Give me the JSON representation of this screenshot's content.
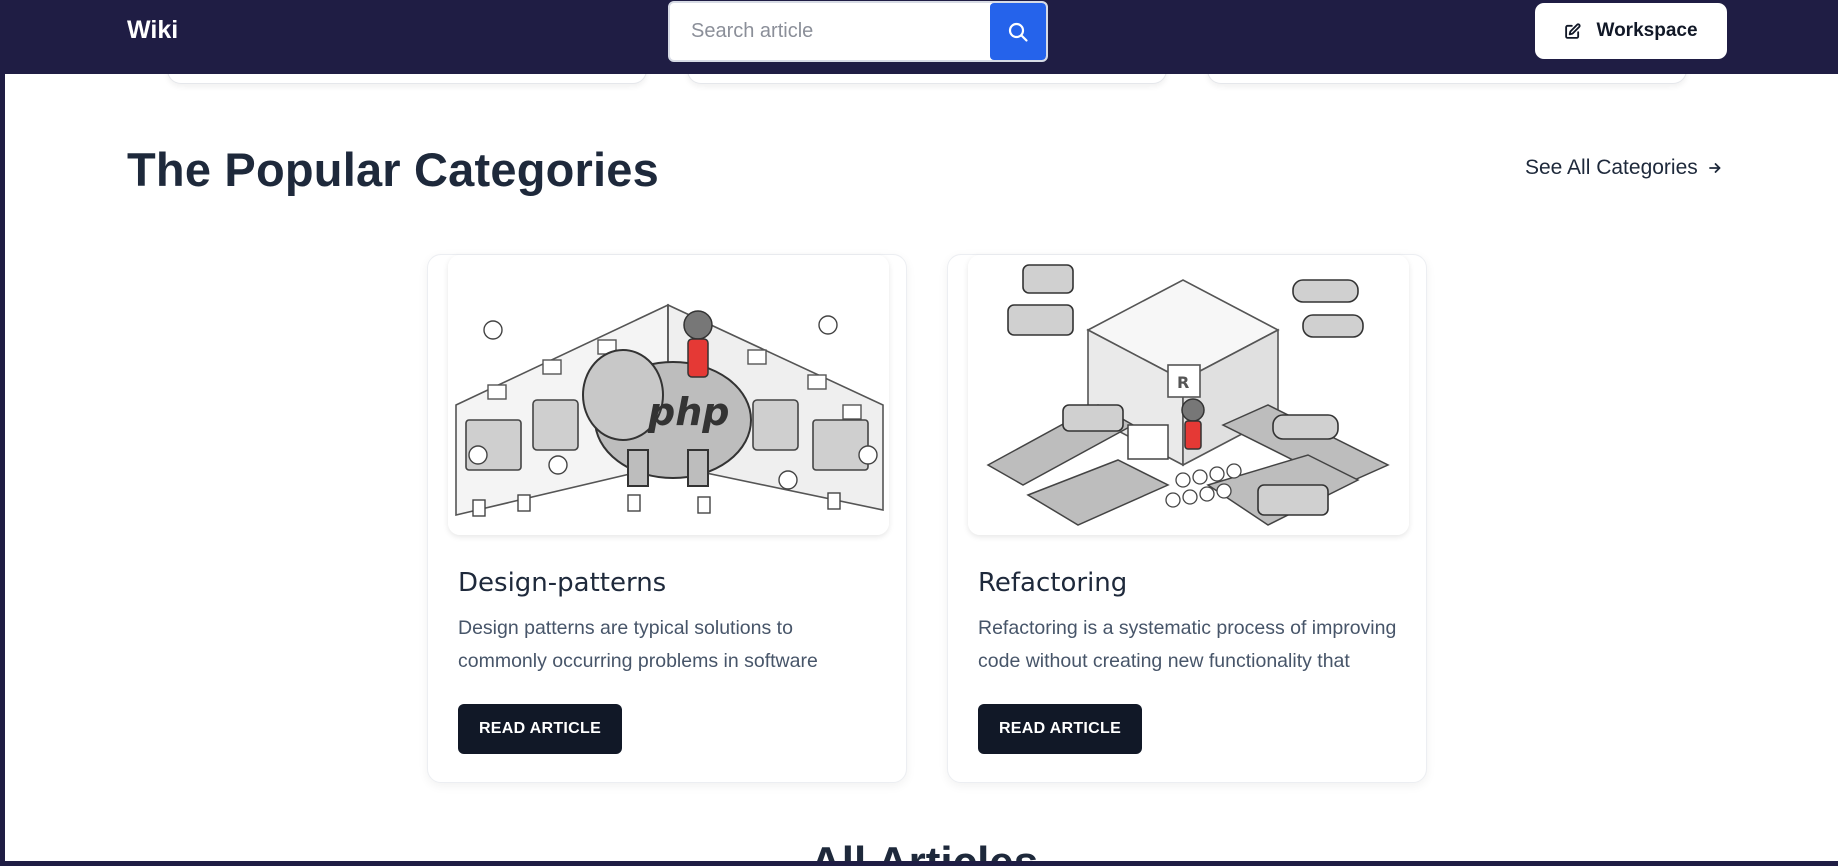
{
  "navbar": {
    "brand": "Wiki",
    "search_placeholder": "Search article",
    "search_icon": "search-icon",
    "workspace_label": "Workspace",
    "workspace_icon": "edit-icon",
    "bg_color": "#1f1d44",
    "search_btn_color": "#2563eb"
  },
  "popular": {
    "title": "The Popular Categories",
    "see_all_label": "See All Categories",
    "see_all_icon": "arrow-right-icon"
  },
  "categories": [
    {
      "title": "Design-patterns",
      "description": "Design patterns are typical solutions to commonly occurring problems in software design. They are...",
      "button": "READ ARTICLE",
      "image": "php-elephant-illustration"
    },
    {
      "title": "Refactoring",
      "description": "Refactoring is a systematic process of improving code without creating new functionality that can...",
      "button": "READ ARTICLE",
      "image": "car-factory-illustration"
    }
  ],
  "next_section_title": "All Articles"
}
